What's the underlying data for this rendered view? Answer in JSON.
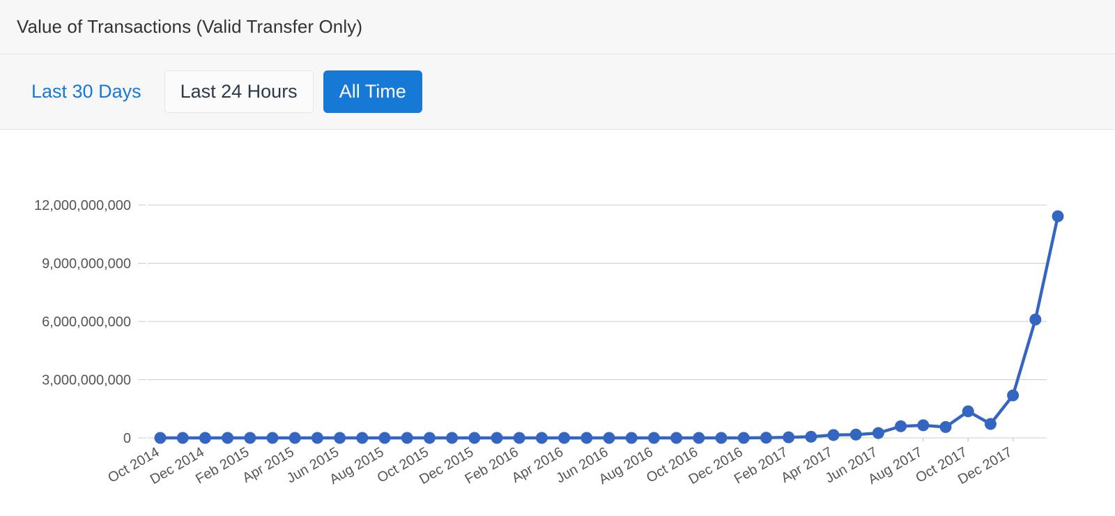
{
  "header": {
    "title": "Value of Transactions (Valid Transfer Only)"
  },
  "tabs": [
    {
      "label": "Last 30 Days",
      "style": "link",
      "active": false
    },
    {
      "label": "Last 24 Hours",
      "style": "outline",
      "active": false
    },
    {
      "label": "All Time",
      "style": "active",
      "active": true
    }
  ],
  "colors": {
    "accent": "#1779d6",
    "series": "#3465c0",
    "grid": "#cccccc",
    "header_bg": "#f7f7f7",
    "tick_text": "#555555",
    "title_text": "#333333"
  },
  "chart_data": {
    "type": "line",
    "title": "",
    "xlabel": "",
    "ylabel": "",
    "ylim": [
      0,
      12000000000
    ],
    "grid": true,
    "legend": "none",
    "ytick_labels": [
      "0",
      "3,000,000,000",
      "6,000,000,000",
      "9,000,000,000",
      "12,000,000,000"
    ],
    "ytick_values": [
      0,
      3000000000,
      6000000000,
      9000000000,
      12000000000
    ],
    "xtick_labels": [
      "Oct 2014",
      "Dec 2014",
      "Feb 2015",
      "Apr 2015",
      "Jun 2015",
      "Aug 2015",
      "Oct 2015",
      "Dec 2015",
      "Feb 2016",
      "Apr 2016",
      "Jun 2016",
      "Aug 2016",
      "Oct 2016",
      "Dec 2016",
      "Feb 2017",
      "Apr 2017",
      "Jun 2017",
      "Aug 2017",
      "Oct 2017",
      "Dec 2017"
    ],
    "xtick_every": 2,
    "xtick_rotation": -30,
    "categories": [
      "Oct 2014",
      "Nov 2014",
      "Dec 2014",
      "Jan 2015",
      "Feb 2015",
      "Mar 2015",
      "Apr 2015",
      "May 2015",
      "Jun 2015",
      "Jul 2015",
      "Aug 2015",
      "Sep 2015",
      "Oct 2015",
      "Nov 2015",
      "Dec 2015",
      "Jan 2016",
      "Feb 2016",
      "Mar 2016",
      "Apr 2016",
      "May 2016",
      "Jun 2016",
      "Jul 2016",
      "Aug 2016",
      "Sep 2016",
      "Oct 2016",
      "Nov 2016",
      "Dec 2016",
      "Jan 2017",
      "Feb 2017",
      "Mar 2017",
      "Apr 2017",
      "May 2017",
      "Jun 2017",
      "Jul 2017",
      "Aug 2017",
      "Sep 2017",
      "Oct 2017",
      "Nov 2017",
      "Dec 2017",
      "Jan 2018"
    ],
    "series": [
      {
        "name": "Value of Transactions",
        "values": [
          0,
          0,
          0,
          0,
          0,
          0,
          0,
          0,
          0,
          0,
          0,
          0,
          0,
          0,
          0,
          0,
          0,
          0,
          0,
          0,
          0,
          0,
          0,
          0,
          0,
          0,
          0,
          10000000,
          30000000,
          60000000,
          150000000,
          170000000,
          250000000,
          600000000,
          650000000,
          560000000,
          1370000000,
          720000000,
          2190000000,
          6100000000
        ]
      }
    ],
    "last_point": {
      "category": "Feb 2018",
      "value": 11420000000
    }
  }
}
